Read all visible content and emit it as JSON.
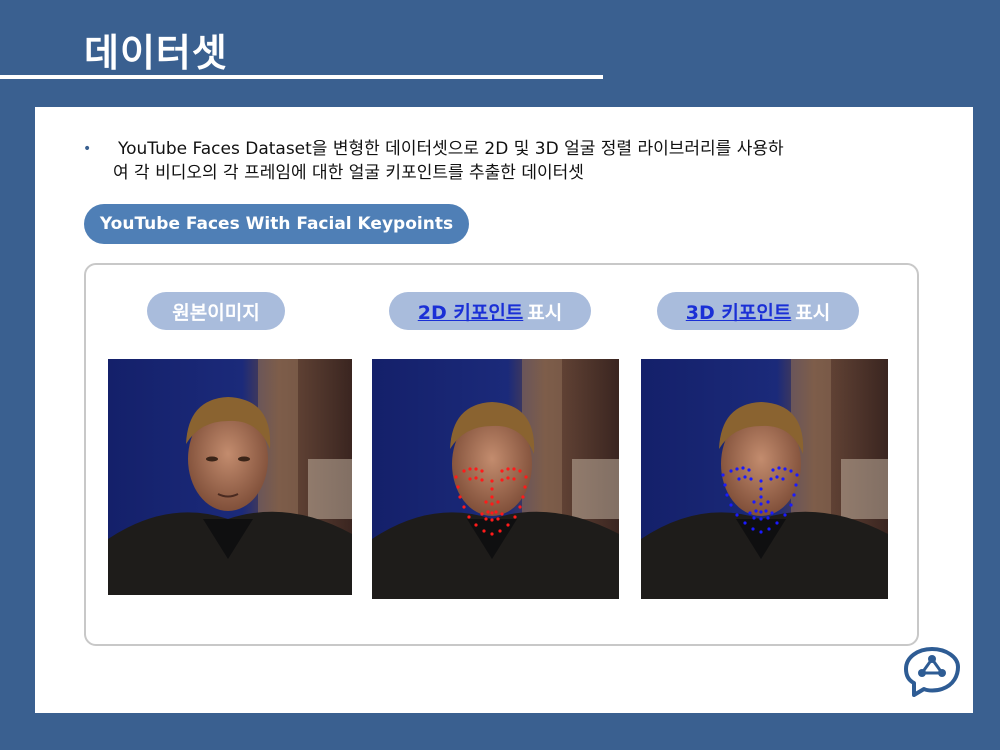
{
  "slide": {
    "title": "데이터셋"
  },
  "bullet": {
    "line1": "YouTube Faces Dataset을 변형한 데이터셋으로 2D 및 3D 얼굴 정렬 라이브러리를 사용하",
    "line2": "여 각 비디오의 각 프레임에 대한 얼굴 키포인트를 추출한 데이터셋"
  },
  "dataset_label": "YouTube Faces With Facial Keypoints",
  "panels": [
    {
      "label": "원본이미지"
    },
    {
      "link": "2D 키포인트 ",
      "suffix": "표시",
      "keypoint_color": "#ff1a1a"
    },
    {
      "link": "3D 키포인트 ",
      "suffix": "표시",
      "keypoint_color": "#1a1aff"
    }
  ],
  "colors": {
    "background": "#3a6090",
    "accent_pill": "#4f7fb6",
    "label_pill": "#a9bcdc",
    "link": "#1a2fd6"
  },
  "icons": {
    "logo": "brain-network-icon"
  }
}
